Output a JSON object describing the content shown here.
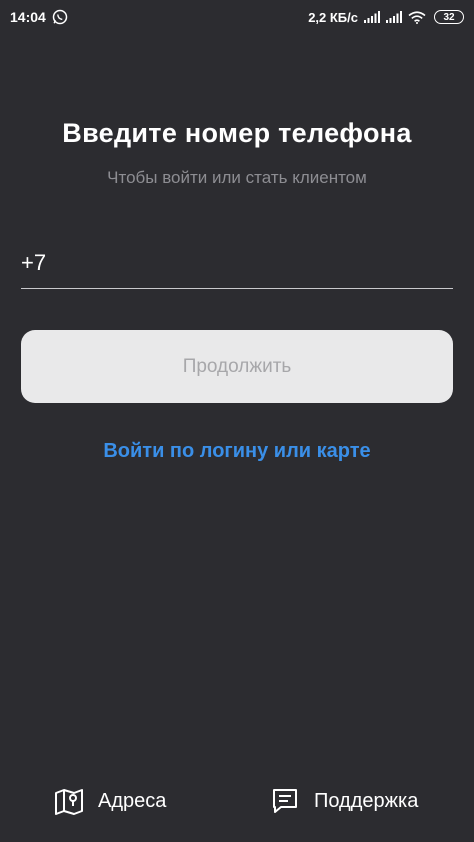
{
  "status_bar": {
    "time": "14:04",
    "speed": "2,2 КБ/с",
    "battery": "32",
    "icons": [
      "whatsapp-icon",
      "signal-icon",
      "signal-icon",
      "wifi-icon",
      "battery-icon"
    ]
  },
  "login": {
    "title": "Введите номер телефона",
    "subtitle": "Чтобы войти или стать клиентом",
    "phone_value": "+7",
    "continue_label": "Продолжить",
    "alt_login_label": "Войти по логину или карте"
  },
  "bottom_nav": {
    "addresses_label": "Адреса",
    "addresses_icon": "map-icon",
    "support_label": "Поддержка",
    "support_icon": "chat-icon"
  },
  "colors": {
    "background": "#2c2c30",
    "accent": "#3a8fe8",
    "button_bg": "#e9e9ea",
    "button_text": "#a7a7aa",
    "subtitle": "#8d8d92"
  }
}
